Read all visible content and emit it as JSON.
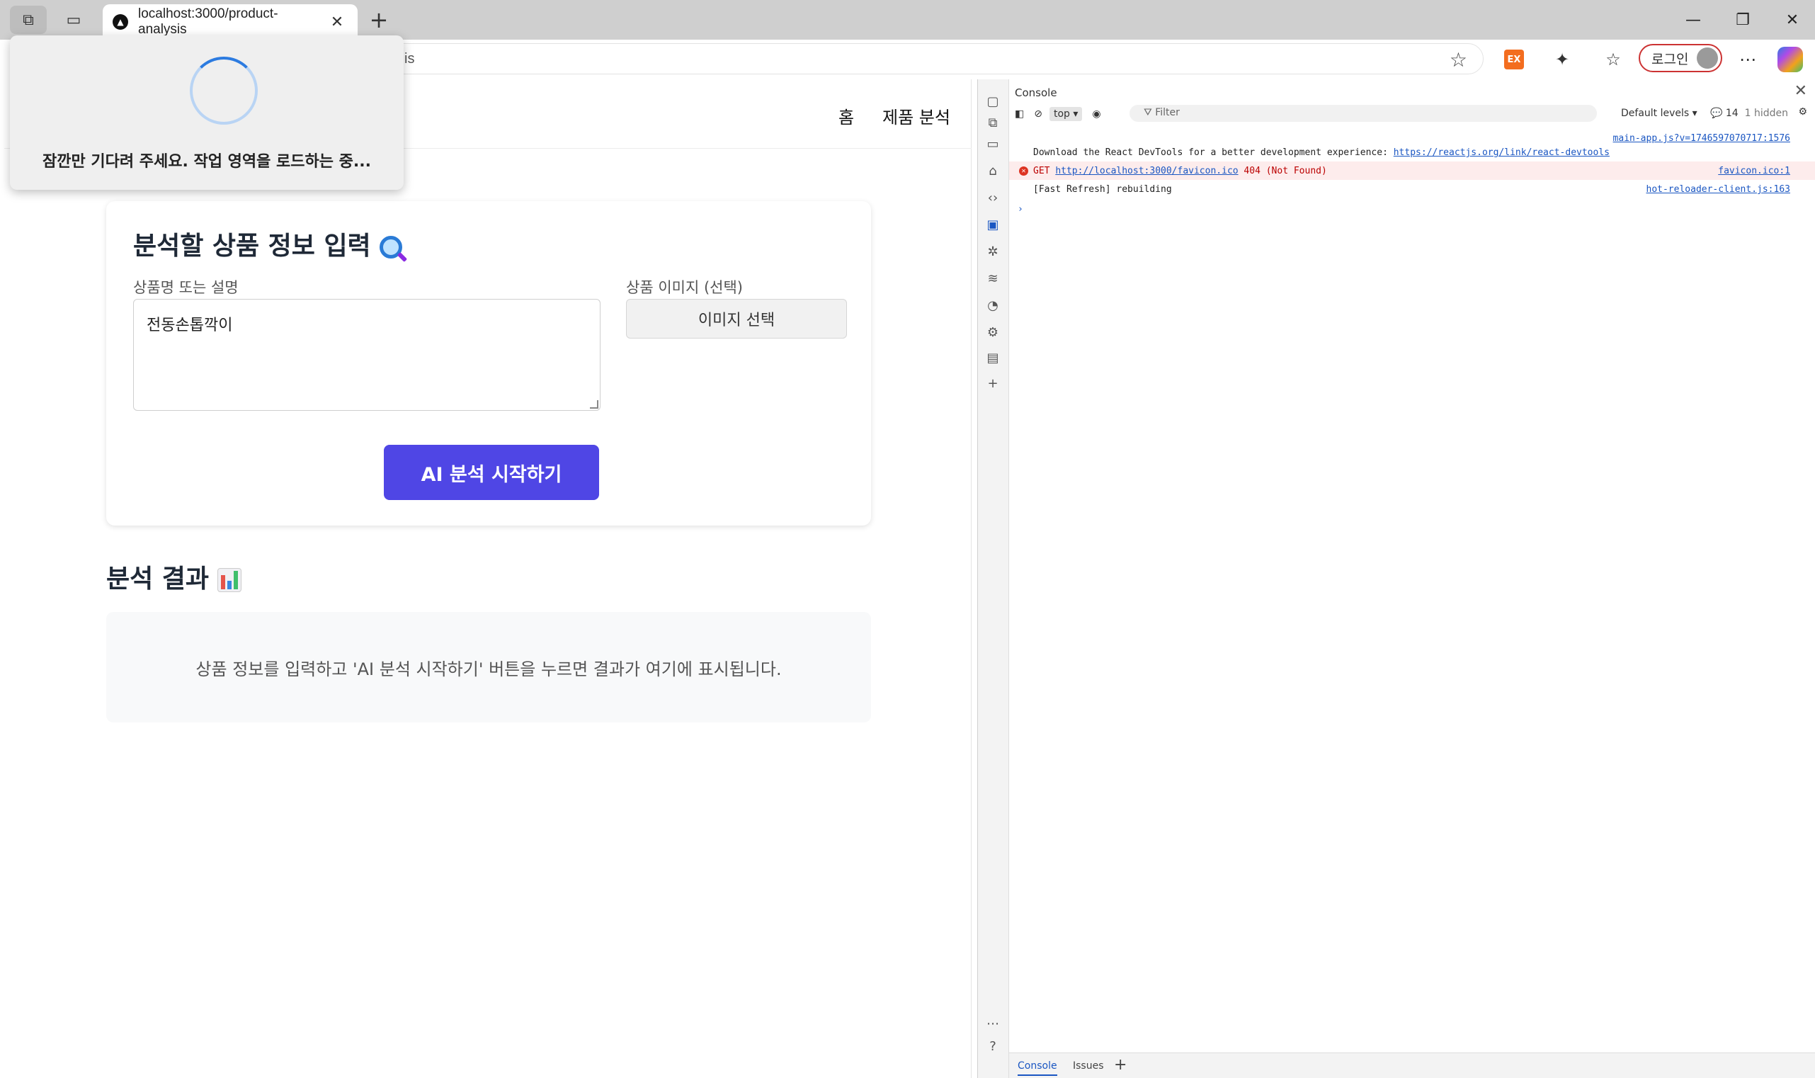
{
  "browser": {
    "tab_title": "localhost:3000/product-analysis",
    "address_fragment": "is",
    "login_label": "로그인"
  },
  "nav": {
    "home": "홈",
    "product_analysis": "제품 분석"
  },
  "popup": {
    "message": "잠깐만 기다려 주세요. 작업 영역을 로드하는 중..."
  },
  "form": {
    "title": "분석할 상품 정보 입력",
    "name_label": "상품명 또는 설명",
    "name_value": "전동손톱깍이",
    "image_label": "상품 이미지 (선택)",
    "image_button": "이미지 선택",
    "submit": "AI 분석 시작하기"
  },
  "results": {
    "title": "분석 결과",
    "placeholder": "상품 정보를 입력하고 'AI 분석 시작하기' 버튼을 누르면 결과가 여기에 표시됩니다."
  },
  "devtools": {
    "panel_title": "Console",
    "context": "top",
    "filter_placeholder": "Filter",
    "levels": "Default levels",
    "count": "14",
    "hidden": "1 hidden",
    "logs": [
      {
        "text": "Download the React DevTools for a better development experience: ",
        "link": "https://reactjs.org/link/react-devtools",
        "source": "main-app.js?v=1746597070717:1576"
      },
      {
        "prefix": "GET ",
        "link": "http://localhost:3000/favicon.ico",
        "text": " 404 (Not Found)",
        "source": "favicon.ico:1"
      },
      {
        "text": "[Fast Refresh] rebuilding",
        "source": "hot-reloader-client.js:163"
      }
    ],
    "bottom_tabs": [
      "Console",
      "Issues"
    ]
  }
}
